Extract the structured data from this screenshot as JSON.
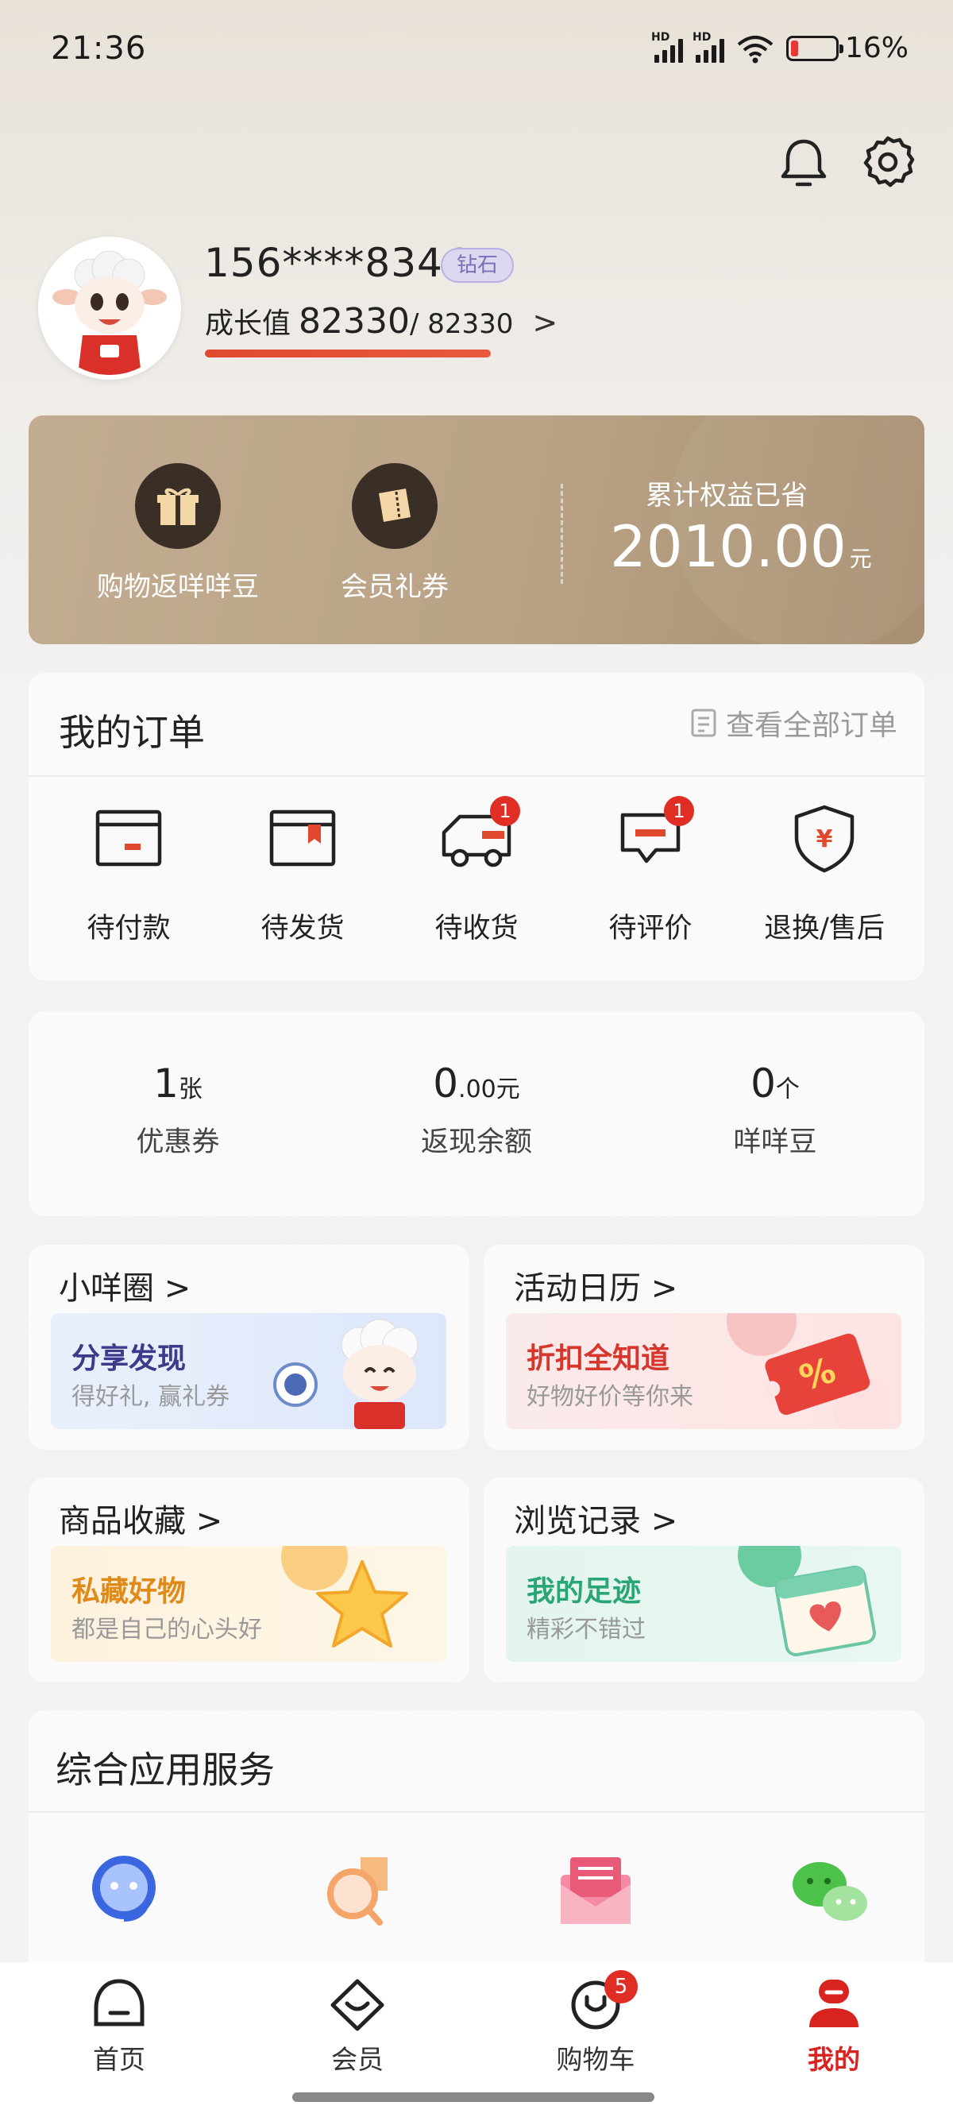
{
  "status": {
    "time": "21:36",
    "battery": "16%",
    "battery_level": 0.16,
    "signal_label": "HD"
  },
  "profile": {
    "phone": "156****8344",
    "level": "钻石",
    "growth_label": "成长值",
    "growth_value": "82330",
    "growth_max": "/ 82330",
    "growth_progress": 1.0
  },
  "member": {
    "items": [
      {
        "label": "购物返咩咩豆",
        "icon": "gift-icon"
      },
      {
        "label": "会员礼券",
        "icon": "coupon-icon"
      }
    ],
    "saved_title": "累计权益已省",
    "saved_value": "2010.00",
    "saved_unit": "元"
  },
  "orders": {
    "title": "我的订单",
    "view_all": "查看全部订单",
    "items": [
      {
        "label": "待付款",
        "icon": "wallet-icon",
        "badge": ""
      },
      {
        "label": "待发货",
        "icon": "package-icon",
        "badge": ""
      },
      {
        "label": "待收货",
        "icon": "truck-icon",
        "badge": "1"
      },
      {
        "label": "待评价",
        "icon": "comment-icon",
        "badge": "1"
      },
      {
        "label": "退换/售后",
        "icon": "shield-yen-icon",
        "badge": ""
      }
    ]
  },
  "assets": [
    {
      "value": "1",
      "unit": "张",
      "label": "优惠券"
    },
    {
      "value": "0",
      "unit": ".00元",
      "label": "返现余额"
    },
    {
      "value": "0",
      "unit": "个",
      "label": "咩咩豆"
    }
  ],
  "tiles": [
    {
      "title": "小咩圈 >",
      "heading": "分享发现",
      "sub": "得好礼, 赢礼券",
      "accent": "#3d3a8c"
    },
    {
      "title": "活动日历 >",
      "heading": "折扣全知道",
      "sub": "好物好价等你来",
      "accent": "#d6362b"
    },
    {
      "title": "商品收藏 >",
      "heading": "私藏好物",
      "sub": "都是自己的心头好",
      "accent": "#e08a1a"
    },
    {
      "title": "浏览记录 >",
      "heading": "我的足迹",
      "sub": "精彩不错过",
      "accent": "#2aa676"
    }
  ],
  "services": {
    "title": "综合应用服务"
  },
  "tabs": [
    {
      "label": "首页",
      "icon": "home-icon"
    },
    {
      "label": "会员",
      "icon": "member-icon"
    },
    {
      "label": "购物车",
      "icon": "cart-icon",
      "badge": "5"
    },
    {
      "label": "我的",
      "icon": "profile-icon"
    }
  ],
  "colors": {
    "brand_red": "#d8231f",
    "card_gold": "#b9a285",
    "badge_red": "#e02e24"
  }
}
